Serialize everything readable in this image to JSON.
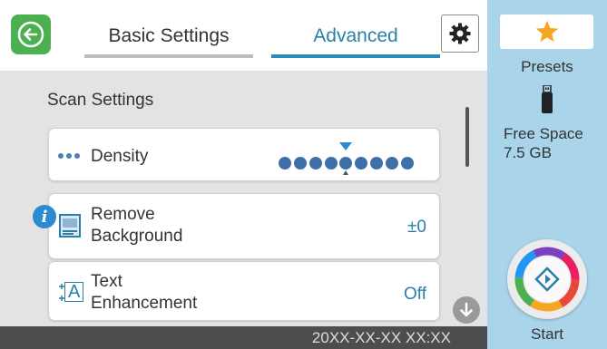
{
  "header": {
    "tabs": [
      {
        "label": "Basic Settings",
        "active": false
      },
      {
        "label": "Advanced",
        "active": true
      }
    ]
  },
  "main": {
    "section_title": "Scan Settings",
    "items": [
      {
        "label": "Density",
        "icon": "density-dots-icon",
        "control": "density-slider"
      },
      {
        "label_line1": "Remove",
        "label_line2": "Background",
        "value": "±0",
        "icon": "remove-background-icon"
      },
      {
        "label_line1": "Text",
        "label_line2": "Enhancement",
        "value": "Off",
        "icon": "text-enhancement-icon"
      }
    ]
  },
  "footer": {
    "datetime": "20XX-XX-XX XX:XX"
  },
  "sidebar": {
    "presets_label": "Presets",
    "free_space_label": "Free Space",
    "free_space_value": "7.5 GB",
    "start_label": "Start"
  },
  "colors": {
    "accent": "#2b7fa8",
    "back_button": "#4caf50",
    "side_panel": "#a9d4ea",
    "content_bg": "#e3e3e3",
    "footer_bg": "#4d4d4d",
    "star": "#f5a623"
  }
}
